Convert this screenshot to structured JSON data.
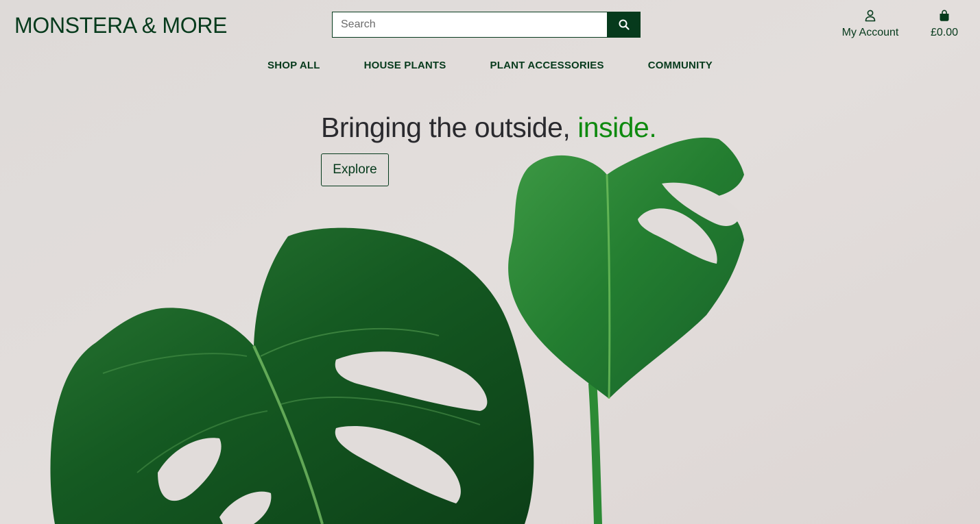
{
  "header": {
    "brand": "MONSTERA & MORE",
    "search": {
      "placeholder": "Search",
      "value": "",
      "button_icon": "search-icon"
    },
    "account": {
      "icon": "user-icon",
      "label": "My Account"
    },
    "bag": {
      "icon": "shopping-bag-icon",
      "total": "£0.00"
    }
  },
  "nav": {
    "items": [
      {
        "label": "SHOP ALL"
      },
      {
        "label": "HOUSE PLANTS"
      },
      {
        "label": "PLANT ACCESSORIES"
      },
      {
        "label": "COMMUNITY"
      }
    ]
  },
  "hero": {
    "title_main": "Bringing the outside, ",
    "title_accent": "inside.",
    "cta_label": "Explore",
    "image": "monstera-leaves-photo"
  },
  "colors": {
    "brand_dark_green": "#063a1c",
    "accent_green": "#0e8a0f",
    "background": "#e1dcda",
    "leaf_green": "#1f6b2c"
  }
}
